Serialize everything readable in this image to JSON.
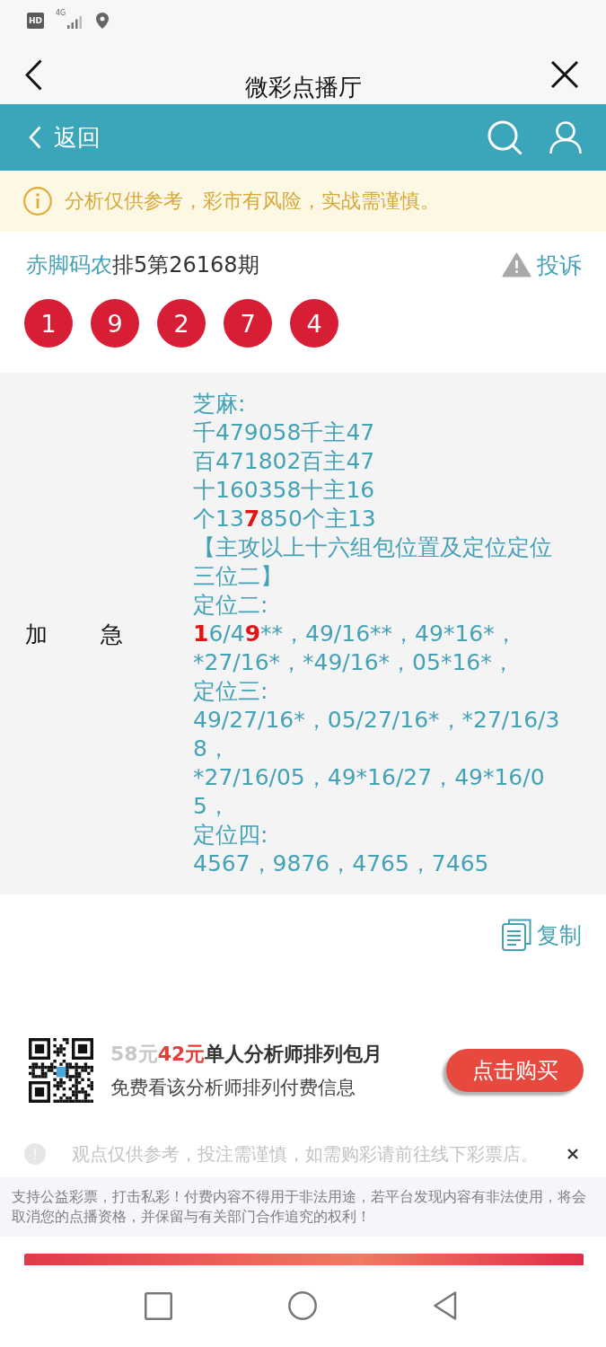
{
  "status_bar": {
    "hd_badge": "HD",
    "network": "4G"
  },
  "title_bar": {
    "title": "微彩点播厅"
  },
  "nav_bar": {
    "back_label": "返回"
  },
  "warning": {
    "text": "分析仅供参考，彩市有风险，实战需谨慎。"
  },
  "issue": {
    "author": "赤脚码农",
    "title": "排5第26168期",
    "complaint": "投诉",
    "balls": [
      "1",
      "9",
      "2",
      "7",
      "4"
    ]
  },
  "analysis": {
    "label": "加　　急",
    "lines": [
      [
        {
          "text": "芝麻:",
          "highlight": false
        }
      ],
      [
        {
          "text": "千479058千主47",
          "highlight": false
        }
      ],
      [
        {
          "text": "百471802百主47",
          "highlight": false
        }
      ],
      [
        {
          "text": "十160358十主16",
          "highlight": false
        }
      ],
      [
        {
          "text": "个13",
          "highlight": false
        },
        {
          "text": "7",
          "highlight": true
        },
        {
          "text": "850个主13",
          "highlight": false
        }
      ],
      [
        {
          "text": "【主攻以上十六组包位置及定位定位",
          "highlight": false
        }
      ],
      [
        {
          "text": "三位二】",
          "highlight": false
        }
      ],
      [
        {
          "text": "定位二:",
          "highlight": false
        }
      ],
      [
        {
          "text": "1",
          "highlight": true
        },
        {
          "text": "6/4",
          "highlight": false
        },
        {
          "text": "9",
          "highlight": true
        },
        {
          "text": "**，49/16**，49*16*，",
          "highlight": false
        }
      ],
      [
        {
          "text": "*27/16*，*49/16*，05*16*，",
          "highlight": false
        }
      ],
      [
        {
          "text": "定位三:",
          "highlight": false
        }
      ],
      [
        {
          "text": "49/27/16*，05/27/16*，*27/16/3",
          "highlight": false
        }
      ],
      [
        {
          "text": "8，",
          "highlight": false
        }
      ],
      [
        {
          "text": "*27/16/05，49*16/27，49*16/0",
          "highlight": false
        }
      ],
      [
        {
          "text": "5，",
          "highlight": false
        }
      ],
      [
        {
          "text": "定位四:",
          "highlight": false
        }
      ],
      [
        {
          "text": "4567，9876，4765，7465",
          "highlight": false
        }
      ]
    ]
  },
  "copy": {
    "label": "复制"
  },
  "promo": {
    "old_price": "58元",
    "price": "42元",
    "title": "单人分析师排列包月",
    "subtitle": "免费看该分析师排列付费信息",
    "button": "点击购买"
  },
  "notice": {
    "text": "观点仅供参考，投注需谨慎，如需购彩请前往线下彩票店。"
  },
  "disclaimer": {
    "text": "支持公益彩票，打击私彩！付费内容不得用于非法用途，若平台发现内容有非法使用，将会取消您的点播资格，并保留与有关部门合作追究的权利！"
  }
}
